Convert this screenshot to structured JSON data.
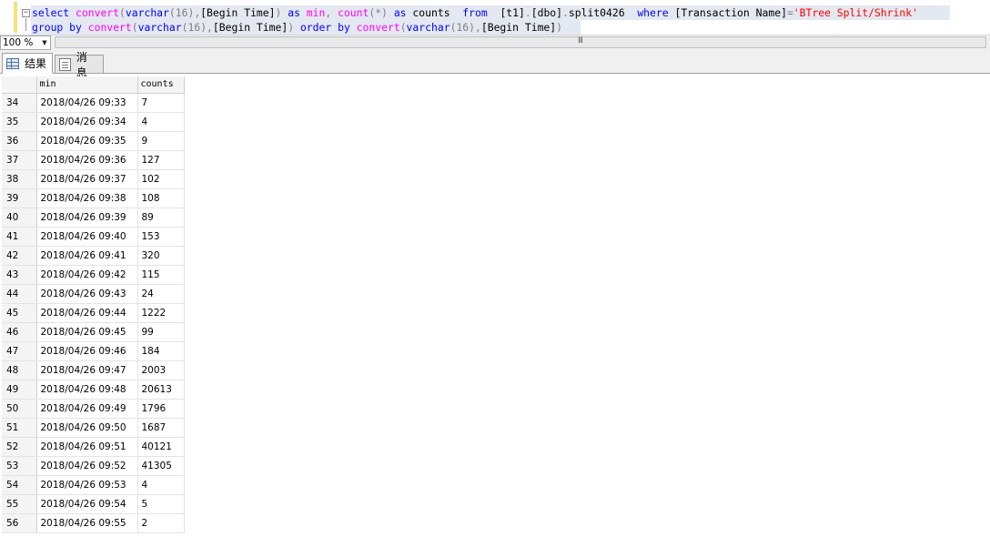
{
  "query": {
    "fold_symbol": "−",
    "line1": [
      {
        "t": "select ",
        "c": "kw"
      },
      {
        "t": "convert",
        "c": "fn"
      },
      {
        "t": "(",
        "c": "gray"
      },
      {
        "t": "varchar",
        "c": "kw"
      },
      {
        "t": "(16),",
        "c": "gray"
      },
      {
        "t": "[Begin Time]",
        "c": ""
      },
      {
        "t": ") ",
        "c": "gray"
      },
      {
        "t": "as ",
        "c": "kw"
      },
      {
        "t": "min",
        "c": "fn"
      },
      {
        "t": ", ",
        "c": "gray"
      },
      {
        "t": "count",
        "c": "fn"
      },
      {
        "t": "(*) ",
        "c": "gray"
      },
      {
        "t": "as ",
        "c": "kw"
      },
      {
        "t": "counts  ",
        "c": ""
      },
      {
        "t": "from  ",
        "c": "kw"
      },
      {
        "t": "[t1]",
        "c": ""
      },
      {
        "t": ".",
        "c": "gray"
      },
      {
        "t": "[dbo]",
        "c": ""
      },
      {
        "t": ".",
        "c": "gray"
      },
      {
        "t": "split0426  ",
        "c": ""
      },
      {
        "t": "where ",
        "c": "kw"
      },
      {
        "t": "[Transaction Name]",
        "c": ""
      },
      {
        "t": "=",
        "c": "gray"
      },
      {
        "t": "'BTree Split/Shrink'",
        "c": "str"
      }
    ],
    "line2": [
      {
        "t": "group by ",
        "c": "kw"
      },
      {
        "t": "convert",
        "c": "fn"
      },
      {
        "t": "(",
        "c": "gray"
      },
      {
        "t": "varchar",
        "c": "kw"
      },
      {
        "t": "(16),",
        "c": "gray"
      },
      {
        "t": "[Begin Time]",
        "c": ""
      },
      {
        "t": ") ",
        "c": "gray"
      },
      {
        "t": "order by ",
        "c": "kw"
      },
      {
        "t": "convert",
        "c": "fn"
      },
      {
        "t": "(",
        "c": "gray"
      },
      {
        "t": "varchar",
        "c": "kw"
      },
      {
        "t": "(16),",
        "c": "gray"
      },
      {
        "t": "[Begin Time]",
        "c": ""
      },
      {
        "t": ")",
        "c": "gray"
      }
    ]
  },
  "toolbar": {
    "zoom_value": "100 %",
    "zoom_arrow": "▼",
    "scroll_grip": "III"
  },
  "tabs": {
    "results_label": "结果",
    "messages_label": "消息"
  },
  "grid": {
    "columns": [
      "min",
      "counts"
    ],
    "rows": [
      {
        "n": "34",
        "min": "2018/04/26 09:33",
        "counts": "7"
      },
      {
        "n": "35",
        "min": "2018/04/26 09:34",
        "counts": "4"
      },
      {
        "n": "36",
        "min": "2018/04/26 09:35",
        "counts": "9"
      },
      {
        "n": "37",
        "min": "2018/04/26 09:36",
        "counts": "127"
      },
      {
        "n": "38",
        "min": "2018/04/26 09:37",
        "counts": "102"
      },
      {
        "n": "39",
        "min": "2018/04/26 09:38",
        "counts": "108"
      },
      {
        "n": "40",
        "min": "2018/04/26 09:39",
        "counts": "89"
      },
      {
        "n": "41",
        "min": "2018/04/26 09:40",
        "counts": "153"
      },
      {
        "n": "42",
        "min": "2018/04/26 09:41",
        "counts": "320"
      },
      {
        "n": "43",
        "min": "2018/04/26 09:42",
        "counts": "115"
      },
      {
        "n": "44",
        "min": "2018/04/26 09:43",
        "counts": "24"
      },
      {
        "n": "45",
        "min": "2018/04/26 09:44",
        "counts": "1222"
      },
      {
        "n": "46",
        "min": "2018/04/26 09:45",
        "counts": "99"
      },
      {
        "n": "47",
        "min": "2018/04/26 09:46",
        "counts": "184"
      },
      {
        "n": "48",
        "min": "2018/04/26 09:47",
        "counts": "2003"
      },
      {
        "n": "49",
        "min": "2018/04/26 09:48",
        "counts": "20613"
      },
      {
        "n": "50",
        "min": "2018/04/26 09:49",
        "counts": "1796"
      },
      {
        "n": "51",
        "min": "2018/04/26 09:50",
        "counts": "1687"
      },
      {
        "n": "52",
        "min": "2018/04/26 09:51",
        "counts": "40121"
      },
      {
        "n": "53",
        "min": "2018/04/26 09:52",
        "counts": "41305"
      },
      {
        "n": "54",
        "min": "2018/04/26 09:53",
        "counts": "4"
      },
      {
        "n": "55",
        "min": "2018/04/26 09:54",
        "counts": "5"
      },
      {
        "n": "56",
        "min": "2018/04/26 09:55",
        "counts": "2"
      }
    ]
  }
}
